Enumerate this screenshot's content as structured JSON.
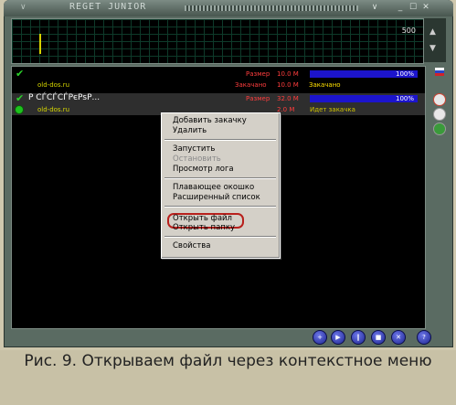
{
  "window": {
    "title": "REGET JUNIOR",
    "chevron": "∨",
    "btn_menu": "∨",
    "btn_min": "_",
    "btn_max": "☐",
    "btn_close": "✕"
  },
  "graph": {
    "value": "500",
    "side_up": "▲",
    "side_down": "▼"
  },
  "downloads": [
    {
      "name": "",
      "domain": "old-dos.ru",
      "size_label": "Размер",
      "size": "10.0 M",
      "done_label": "Закачано",
      "done": "10.0 M",
      "status": "Закачано",
      "percent": "100%",
      "check": "✔"
    },
    {
      "name": "Р СЃСЃСЃРєРѕР...",
      "domain": "old-dos.ru",
      "size_label": "Размер",
      "size": "32.0 M",
      "done": "2.0 M",
      "status": "Идет закачка",
      "percent": "100%",
      "check": "✔"
    }
  ],
  "context_menu": {
    "add": "Добавить закачку",
    "delete": "Удалить",
    "start": "Запустить",
    "stop": "Остановить",
    "log": "Просмотр лога",
    "float": "Плавающее окошко",
    "extended": "Расширенный список",
    "open_file": "Открыть файл",
    "open_folder": "Открыть папку",
    "props": "Свойства"
  },
  "controls": [
    "+",
    "▶",
    "‖",
    "■",
    "✕",
    "?"
  ],
  "caption": "Рис. 9. Открываем файл через контекстное меню"
}
